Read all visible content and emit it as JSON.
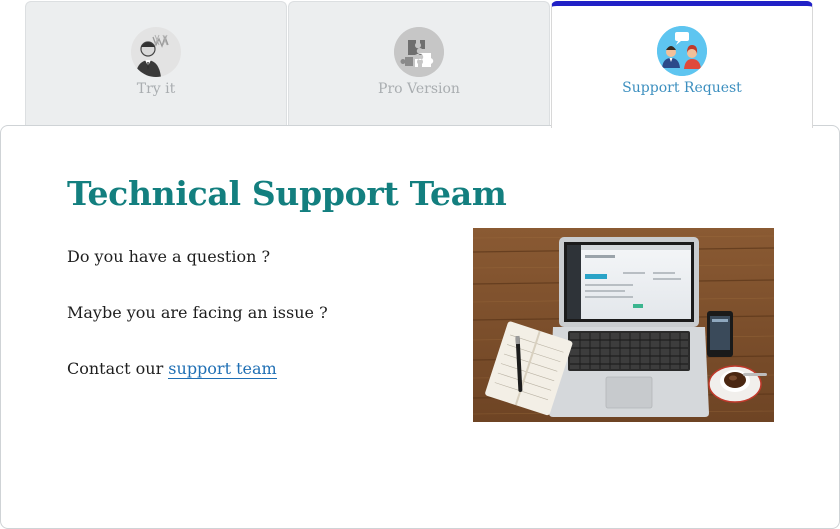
{
  "tabs": [
    {
      "label": "Try it",
      "icon": "businessman-icon",
      "active": false
    },
    {
      "label": "Pro Version",
      "icon": "puzzle-icon",
      "active": false
    },
    {
      "label": "Support Request",
      "icon": "support-people-icon",
      "active": true
    }
  ],
  "content": {
    "title": "Technical Support Team",
    "question_text": "Do you have a question ?",
    "issue_text": "Maybe you are facing an issue ?",
    "contact_prefix": "Contact our ",
    "contact_link": "support team",
    "image": "laptop-desk-photo"
  },
  "colors": {
    "title": "#137f7f",
    "active_tab_border": "#2121c6",
    "active_tab_label": "#3c8fbf",
    "link": "#1f6fb4",
    "inactive_tab_bg": "#eceeef"
  }
}
